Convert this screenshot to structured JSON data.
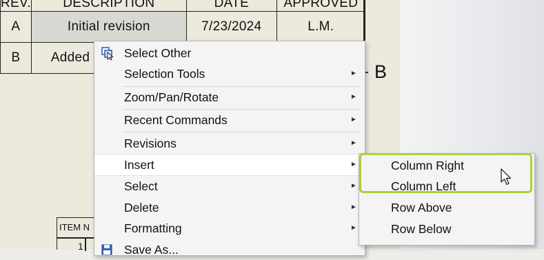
{
  "revision_table": {
    "headers": [
      "REV.",
      "DESCRIPTION",
      "DATE",
      "APPROVED"
    ],
    "rows": [
      {
        "rev": "A",
        "description": "Initial revision",
        "date": "7/23/2024",
        "approved": "L.M."
      },
      {
        "rev": "B",
        "description": "Added",
        "date": "",
        "approved": ""
      }
    ]
  },
  "zone_label": "B",
  "bom_table": {
    "header": "ITEM N",
    "first_item": "1"
  },
  "context_menu": {
    "items": [
      {
        "label": "Select Other",
        "icon": "select-other-icon",
        "has_submenu": false
      },
      {
        "label": "Selection Tools",
        "has_submenu": true
      },
      {
        "label": "Zoom/Pan/Rotate",
        "has_submenu": true
      },
      {
        "label": "Recent Commands",
        "has_submenu": true
      },
      {
        "label": "Revisions",
        "has_submenu": true
      },
      {
        "label": "Insert",
        "has_submenu": true,
        "active": true
      },
      {
        "label": "Select",
        "has_submenu": true
      },
      {
        "label": "Delete",
        "has_submenu": true
      },
      {
        "label": "Formatting",
        "has_submenu": true
      },
      {
        "label": "Save As...",
        "icon": "save-as-icon",
        "has_submenu": false
      }
    ]
  },
  "insert_submenu": {
    "items": [
      {
        "label": "Column Right"
      },
      {
        "label": "Column Left"
      },
      {
        "label": "Row Above"
      },
      {
        "label": "Row Below"
      }
    ]
  },
  "colors": {
    "highlight": "#a9d23a",
    "menu_bg": "#f4f4f4"
  }
}
